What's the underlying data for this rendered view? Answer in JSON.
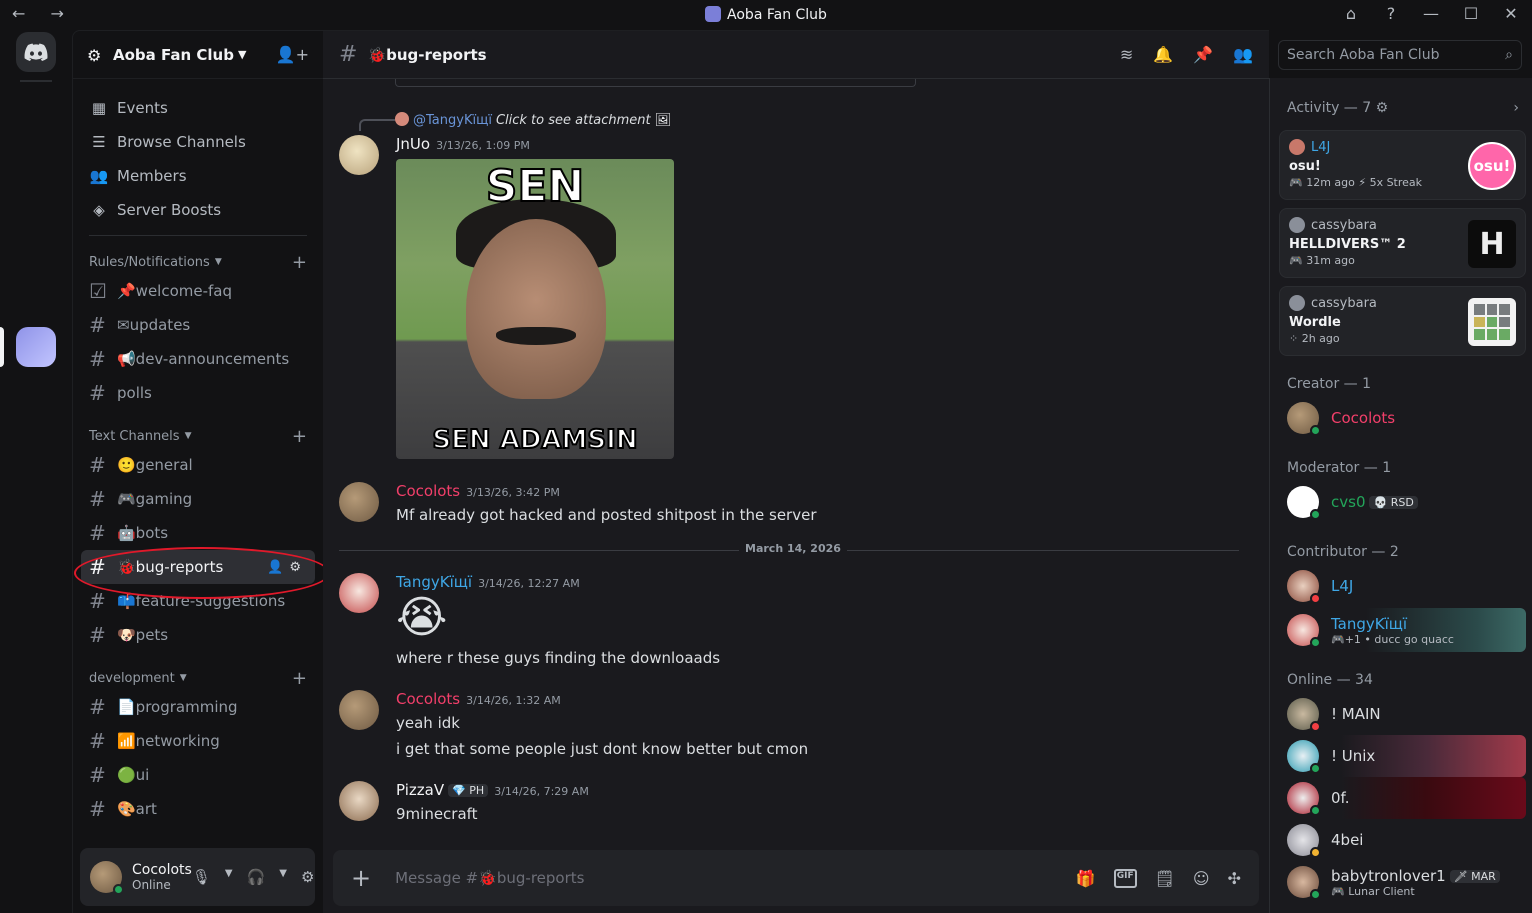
{
  "window": {
    "title": "Aoba Fan Club",
    "nav_arrows": "← →",
    "controls": [
      "⌂",
      "?",
      "—",
      "☐",
      "✕"
    ]
  },
  "server": {
    "name": "Aoba Fan Club",
    "nav": [
      {
        "label": "Events",
        "icon": "calendar-icon"
      },
      {
        "label": "Browse Channels",
        "icon": "browse-icon"
      },
      {
        "label": "Members",
        "icon": "members-icon"
      },
      {
        "label": "Server Boosts",
        "icon": "boost-icon"
      }
    ],
    "categories": [
      {
        "name": "Rules/Notifications",
        "channels": [
          "📌welcome-faq",
          "✉updates",
          "📢dev-announcements",
          "polls"
        ]
      },
      {
        "name": "Text Channels",
        "channels": [
          "🙂general",
          "🎮gaming",
          "🤖bots",
          "🐞bug-reports",
          "📫feature-suggestions",
          "🐶pets"
        ]
      },
      {
        "name": "development",
        "channels": [
          "📄programming",
          "📶networking",
          "🟢ui",
          "🎨art"
        ]
      }
    ]
  },
  "user": {
    "name": "Cocolots",
    "status": "Online"
  },
  "channel": {
    "name": "🐞bug-reports",
    "composer_placeholder": "Message #🐞bug-reports"
  },
  "search": {
    "placeholder": "Search Aoba Fan Club"
  },
  "messages": [
    {
      "reply_to": "@TangyKïщї",
      "reply_text": "Click to see attachment",
      "author": "JnUo",
      "author_color": "#f2f3f5",
      "time": "3/13/26, 1:09 PM",
      "image_top": "SEN",
      "image_bottom": "SEN ADAMSIN"
    },
    {
      "author": "Cocolots",
      "author_color": "#f23f6a",
      "time": "3/13/26, 3:42 PM",
      "lines": [
        "Mf already got hacked and posted shitpost in the server"
      ]
    },
    {
      "author": "TangyKïщї",
      "author_color": "#3fa7e6",
      "time": "3/14/26, 12:27 AM",
      "emoji": "😭",
      "lines": [
        "where r these guys finding the downloaads"
      ]
    },
    {
      "author": "Cocolots",
      "author_color": "#f23f6a",
      "time": "3/14/26, 1:32 AM",
      "lines": [
        "yeah idk",
        "i get that some people just dont know better but cmon"
      ]
    },
    {
      "author": "PizzaV",
      "author_color": "#f2f3f5",
      "tag": "PH",
      "time": "3/14/26, 7:29 AM",
      "lines": [
        "9minecraft"
      ]
    }
  ],
  "date_divider": "March 14, 2026",
  "activity": {
    "title": "Activity — 7",
    "cards": [
      {
        "user": "L4J",
        "game": "osu!",
        "meta": "🎮 12m ago  ⚡ 5x Streak",
        "art_label": "osu!"
      },
      {
        "user": "cassybara",
        "game": "HELLDIVERS™ 2",
        "meta": "🎮 31m ago",
        "art_label": "H"
      },
      {
        "user": "cassybara",
        "game": "Wordle",
        "meta": "2h ago",
        "art_label": ""
      }
    ]
  },
  "members": {
    "creator_title": "Creator — 1",
    "moderator_title": "Moderator — 1",
    "contributor_title": "Contributor — 2",
    "online_title": "Online — 34",
    "creator": [
      {
        "name": "Cocolots",
        "color": "#f23f6a"
      }
    ],
    "moderator": [
      {
        "name": "cvs0",
        "color": "#23a55a",
        "tag": "RSD"
      }
    ],
    "contributor": [
      {
        "name": "L4J",
        "color": "#3fa7e6"
      },
      {
        "name": "TangyKïщї",
        "color": "#3fa7e6",
        "sub": "+1 • ducc go quacc"
      }
    ],
    "online": [
      {
        "name": "! MAIN",
        "color": "#dbdee1"
      },
      {
        "name": "! Unix",
        "color": "#dbdee1"
      },
      {
        "name": "0f.",
        "color": "#dbdee1"
      },
      {
        "name": "4bei",
        "color": "#dbdee1"
      },
      {
        "name": "babytronlover1",
        "color": "#dbdee1",
        "tag": "MAR",
        "sub": "Lunar Client"
      }
    ]
  }
}
